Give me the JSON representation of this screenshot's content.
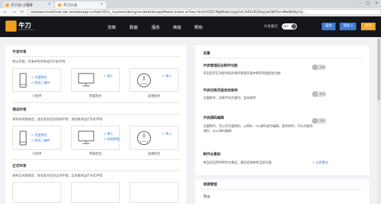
{
  "browser": {
    "tabs": [
      {
        "label": "牛刀云-小程序"
      },
      {
        "label": "牛刀小设"
      }
    ],
    "url": "newdaosmallshop-ide.newdaoapp.cn/ide/UI2/v_/system/designer/webIde/appMaker/index.w?key=bxQrOJ5CMgBbAyUsJgVytCA4ZxRZAzg2eOjB3hmMwBbAyUsJ..."
  },
  "app": {
    "logo_text": "牛刀",
    "logo_sub": "NEWDAO.COM",
    "menu": [
      "页面",
      "数据",
      "服务",
      "高级",
      "帮助"
    ],
    "dev_mode_label": "开发模式",
    "toggle_state": "OFF",
    "save_label": "保存",
    "preview_label": "预览 ▾",
    "publish_label": "发布"
  },
  "left": {
    "sections": [
      {
        "title": "开发环境",
        "desc": "默认环境，开发中的项目运行于此环境",
        "cards": [
          {
            "caption": "小程序",
            "links": [
              "> 页面预览",
              "> 预览二维码"
            ]
          },
          {
            "caption": "管理后台",
            "links": [
              "> 进入"
            ]
          },
          {
            "caption": "运维后台",
            "links": [
              "> 进入"
            ]
          }
        ]
      },
      {
        "title": "测试环境",
        "desc": "发布测试版本后，会生成对应的测试环境，测试版本运行于此环境",
        "cards": [
          {
            "caption": "小程序",
            "links": [
              "> 页面预览",
              "> 预览二维码"
            ]
          },
          {
            "caption": "管理后台",
            "links": [
              "> 进入",
              "> 初始管理"
            ]
          },
          {
            "caption": "运维后台",
            "links": [
              "> 进入"
            ]
          }
        ]
      },
      {
        "title": "正式环境",
        "desc": "发布正式版本后，会生成对应的正式环境，正式版本运行于此环境"
      }
    ]
  },
  "right": {
    "settings_title": "设置",
    "items": [
      {
        "title": "开启管理后台制作功能",
        "desc": "开启后可在顶部导航新增的管理页面中制作管理后台功能",
        "switch": "关闭"
      },
      {
        "title": "开启切换页面自动保存",
        "desc": "页面制作，切换不同页面时，自动保存",
        "switch": "关闭"
      },
      {
        "title": "开启源码编辑",
        "desc": "页面制作，可以对页面源码、js源码、css源码进行编辑；服务制作，可以对服务源码、java源码编辑",
        "switch": "关闭"
      },
      {
        "title": "制作台重启",
        "desc": "将当前应用的制作台重启，重启后请刷新当前页面",
        "link": "> 立即重启"
      }
    ],
    "resources_title": "资源管理",
    "export_label": "导出"
  }
}
